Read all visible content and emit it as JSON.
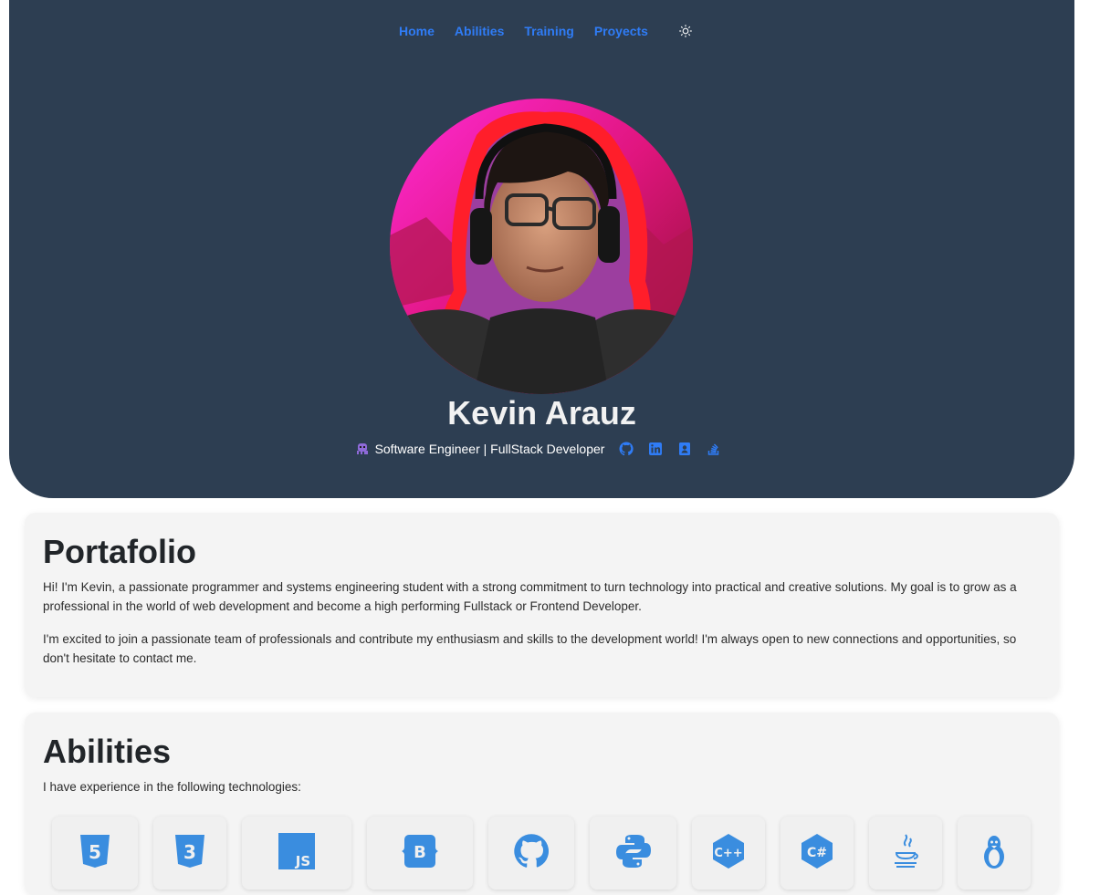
{
  "nav": {
    "items": [
      {
        "label": "Home"
      },
      {
        "label": "Abilities"
      },
      {
        "label": "Training"
      },
      {
        "label": "Proyects"
      }
    ],
    "theme_icon": "sun-icon"
  },
  "profile": {
    "name": "Kevin Arauz",
    "tagline_icon": "alien-monster-icon",
    "tagline": "Software Engineer | FullStack Developer",
    "social": [
      "github-icon",
      "linkedin-icon",
      "portfolio-contact-icon",
      "stackoverflow-icon"
    ]
  },
  "portfolio": {
    "title": "Portafolio",
    "paragraphs": [
      "Hi! I'm Kevin, a passionate programmer and systems engineering student with a strong commitment to turn technology into practical and creative solutions. My goal is to grow as a professional in the world of web development and become a high performing Fullstack or Frontend Developer.",
      "I'm excited to join a passionate team of professionals and contribute my enthusiasm and skills to the development world! I'm always open to new connections and opportunities, so don't hesitate to contact me."
    ]
  },
  "abilities": {
    "title": "Abilities",
    "subtitle": "I have experience in the following technologies:",
    "skills": [
      {
        "icon": "html5-icon",
        "label": "5"
      },
      {
        "icon": "css3-icon",
        "label": "3"
      },
      {
        "icon": "javascript-icon",
        "label": "JS"
      },
      {
        "icon": "bootstrap-icon",
        "label": "B"
      },
      {
        "icon": "github-icon"
      },
      {
        "icon": "python-icon"
      },
      {
        "icon": "cplusplus-icon",
        "label": "C++"
      },
      {
        "icon": "csharp-icon",
        "label": "C#"
      },
      {
        "icon": "java-icon"
      },
      {
        "icon": "linux-icon"
      }
    ]
  },
  "colors": {
    "hero_bg": "#2d3e52",
    "nav_link": "#2f7cf6",
    "card_bg": "#f4f4f4",
    "icon_blue": "#3a8ddf"
  }
}
